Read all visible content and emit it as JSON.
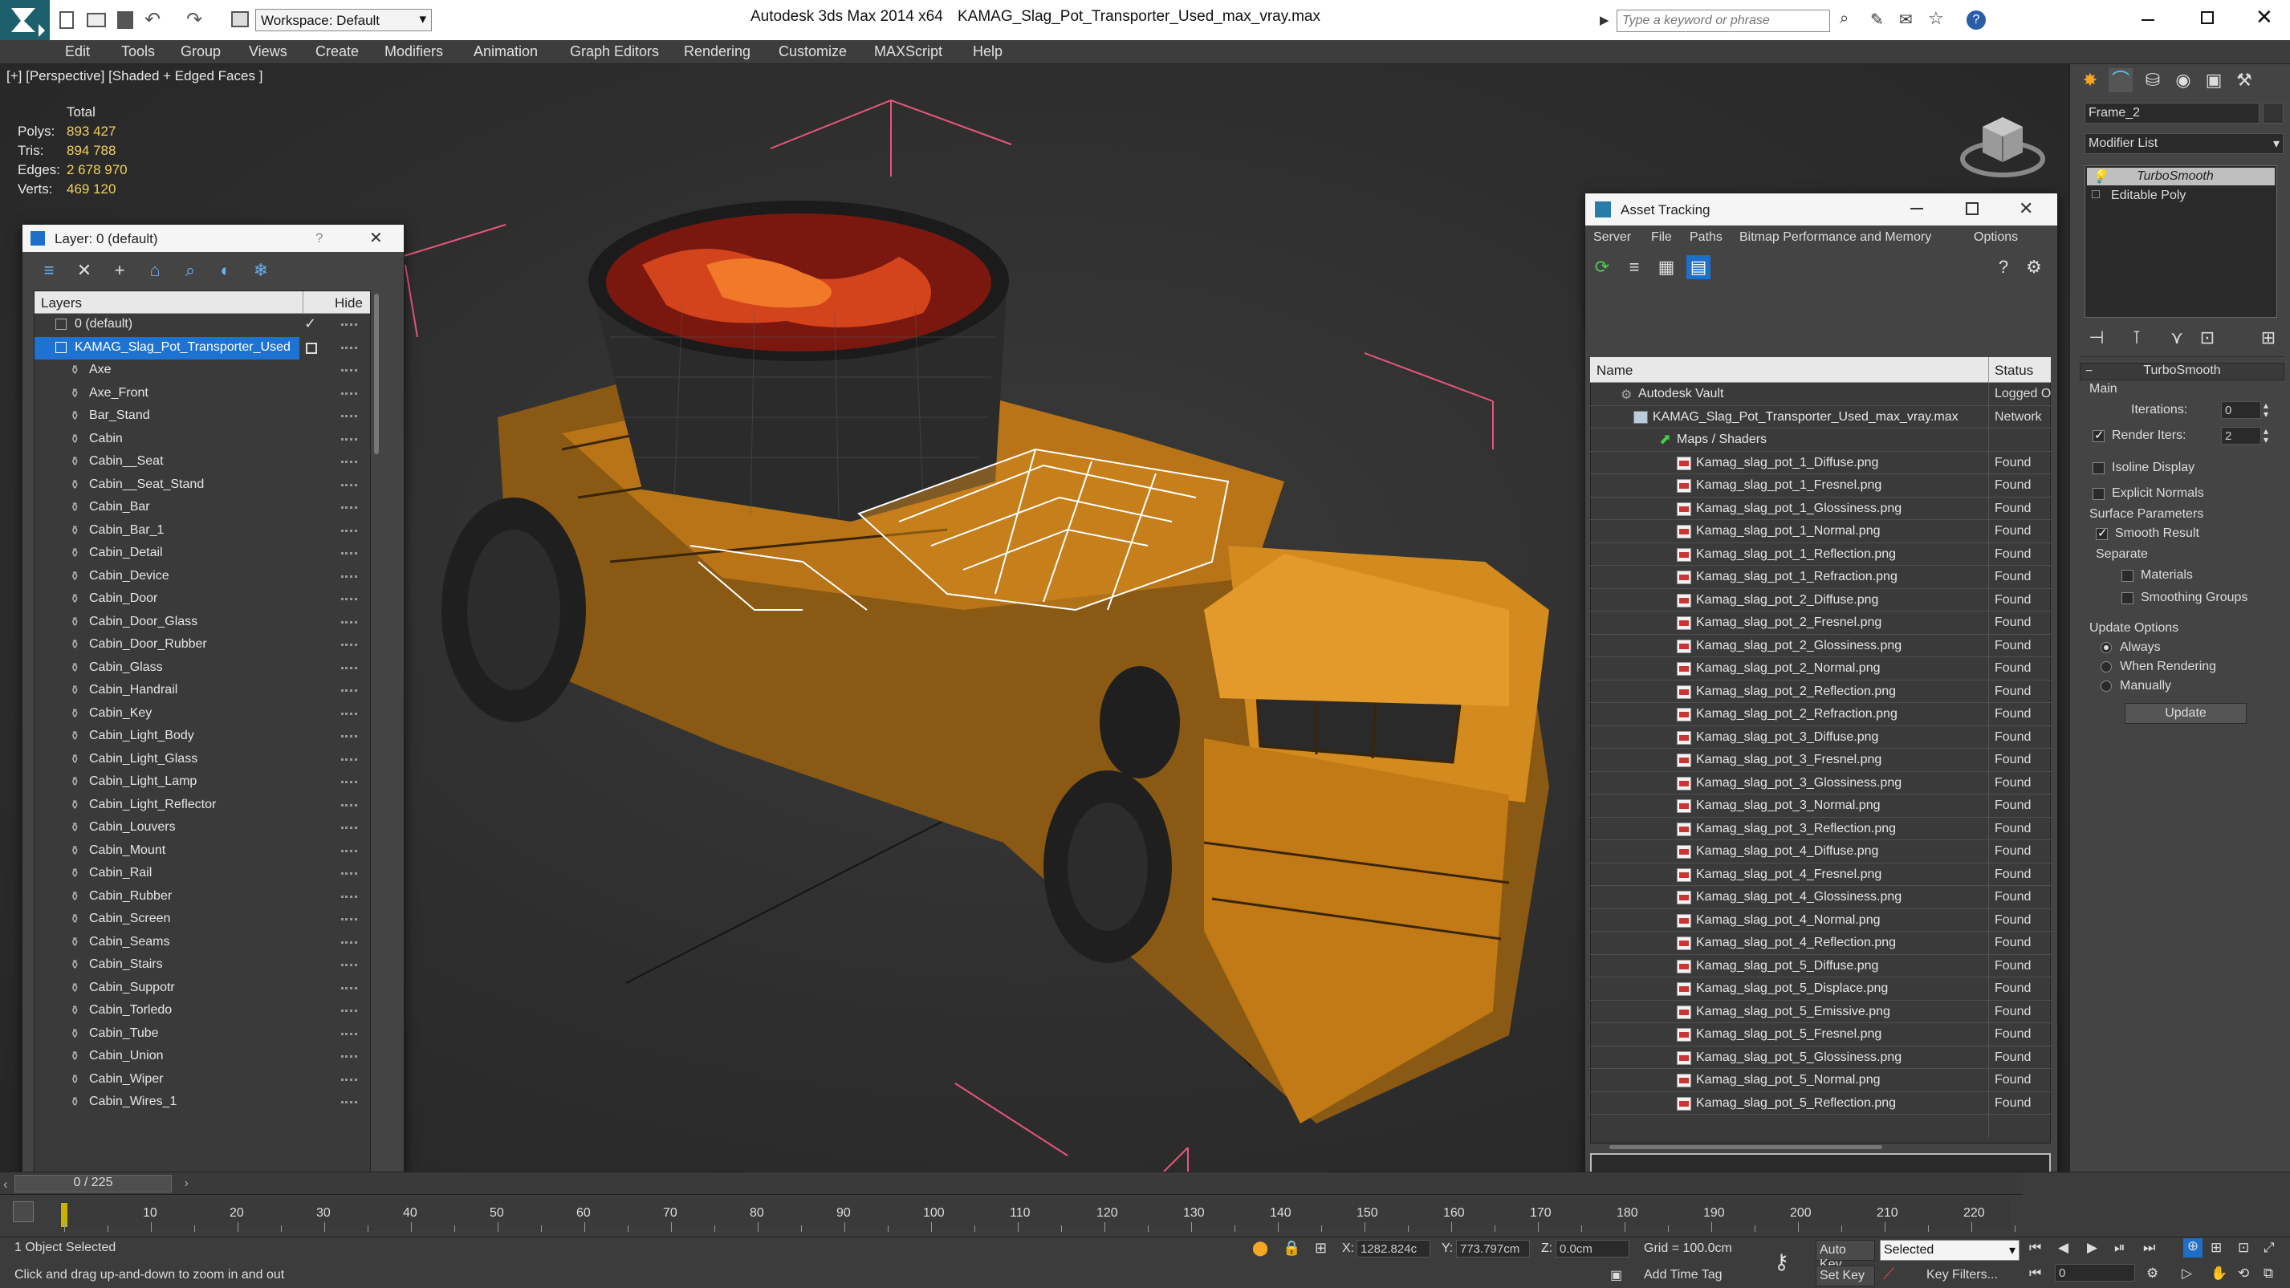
{
  "app": {
    "title": "Autodesk 3ds Max  2014 x64",
    "file": "KAMAG_Slag_Pot_Transporter_Used_max_vray.max",
    "workspace": "Workspace: Default",
    "search_placeholder": "Type a keyword or phrase"
  },
  "menu": [
    "Edit",
    "Tools",
    "Group",
    "Views",
    "Create",
    "Modifiers",
    "Animation",
    "Graph Editors",
    "Rendering",
    "Customize",
    "MAXScript",
    "Help"
  ],
  "viewport": {
    "label": "[+] [Perspective] [Shaded + Edged Faces ]",
    "stats": {
      "header": "Total",
      "rows": [
        {
          "label": "Polys:",
          "value": "893 427"
        },
        {
          "label": "Tris:",
          "value": "894 788"
        },
        {
          "label": "Edges:",
          "value": "2 678 970"
        },
        {
          "label": "Verts:",
          "value": "469 120"
        }
      ]
    }
  },
  "layer_panel": {
    "title": "Layer: 0 (default)",
    "help": "?",
    "col_layers": "Layers",
    "col_hide": "Hide",
    "default_layer": "0 (default)",
    "active_layer": "KAMAG_Slag_Pot_Transporter_Used",
    "objects": [
      "Axe",
      "Axe_Front",
      "Bar_Stand",
      "Cabin",
      "Cabin__Seat",
      "Cabin__Seat_Stand",
      "Cabin_Bar",
      "Cabin_Bar_1",
      "Cabin_Detail",
      "Cabin_Device",
      "Cabin_Door",
      "Cabin_Door_Glass",
      "Cabin_Door_Rubber",
      "Cabin_Glass",
      "Cabin_Handrail",
      "Cabin_Key",
      "Cabin_Light_Body",
      "Cabin_Light_Glass",
      "Cabin_Light_Lamp",
      "Cabin_Light_Reflector",
      "Cabin_Louvers",
      "Cabin_Mount",
      "Cabin_Rail",
      "Cabin_Rubber",
      "Cabin_Screen",
      "Cabin_Seams",
      "Cabin_Stairs",
      "Cabin_Suppotr",
      "Cabin_Torledo",
      "Cabin_Tube",
      "Cabin_Union",
      "Cabin_Wiper",
      "Cabin_Wires_1"
    ]
  },
  "asset_tracking": {
    "title": "Asset Tracking",
    "menu": [
      "Server",
      "File",
      "Paths",
      "Bitmap Performance and Memory",
      "Options"
    ],
    "col_name": "Name",
    "col_status": "Status",
    "vault": {
      "name": "Autodesk Vault",
      "status": "Logged O"
    },
    "file": {
      "name": "KAMAG_Slag_Pot_Transporter_Used_max_vray.max",
      "status": "Network"
    },
    "maps_folder": "Maps / Shaders",
    "maps": [
      {
        "name": "Kamag_slag_pot_1_Diffuse.png",
        "status": "Found"
      },
      {
        "name": "Kamag_slag_pot_1_Fresnel.png",
        "status": "Found"
      },
      {
        "name": "Kamag_slag_pot_1_Glossiness.png",
        "status": "Found"
      },
      {
        "name": "Kamag_slag_pot_1_Normal.png",
        "status": "Found"
      },
      {
        "name": "Kamag_slag_pot_1_Reflection.png",
        "status": "Found"
      },
      {
        "name": "Kamag_slag_pot_1_Refraction.png",
        "status": "Found"
      },
      {
        "name": "Kamag_slag_pot_2_Diffuse.png",
        "status": "Found"
      },
      {
        "name": "Kamag_slag_pot_2_Fresnel.png",
        "status": "Found"
      },
      {
        "name": "Kamag_slag_pot_2_Glossiness.png",
        "status": "Found"
      },
      {
        "name": "Kamag_slag_pot_2_Normal.png",
        "status": "Found"
      },
      {
        "name": "Kamag_slag_pot_2_Reflection.png",
        "status": "Found"
      },
      {
        "name": "Kamag_slag_pot_2_Refraction.png",
        "status": "Found"
      },
      {
        "name": "Kamag_slag_pot_3_Diffuse.png",
        "status": "Found"
      },
      {
        "name": "Kamag_slag_pot_3_Fresnel.png",
        "status": "Found"
      },
      {
        "name": "Kamag_slag_pot_3_Glossiness.png",
        "status": "Found"
      },
      {
        "name": "Kamag_slag_pot_3_Normal.png",
        "status": "Found"
      },
      {
        "name": "Kamag_slag_pot_3_Reflection.png",
        "status": "Found"
      },
      {
        "name": "Kamag_slag_pot_4_Diffuse.png",
        "status": "Found"
      },
      {
        "name": "Kamag_slag_pot_4_Fresnel.png",
        "status": "Found"
      },
      {
        "name": "Kamag_slag_pot_4_Glossiness.png",
        "status": "Found"
      },
      {
        "name": "Kamag_slag_pot_4_Normal.png",
        "status": "Found"
      },
      {
        "name": "Kamag_slag_pot_4_Reflection.png",
        "status": "Found"
      },
      {
        "name": "Kamag_slag_pot_5_Diffuse.png",
        "status": "Found"
      },
      {
        "name": "Kamag_slag_pot_5_Displace.png",
        "status": "Found"
      },
      {
        "name": "Kamag_slag_pot_5_Emissive.png",
        "status": "Found"
      },
      {
        "name": "Kamag_slag_pot_5_Fresnel.png",
        "status": "Found"
      },
      {
        "name": "Kamag_slag_pot_5_Glossiness.png",
        "status": "Found"
      },
      {
        "name": "Kamag_slag_pot_5_Normal.png",
        "status": "Found"
      },
      {
        "name": "Kamag_slag_pot_5_Reflection.png",
        "status": "Found"
      }
    ]
  },
  "command_panel": {
    "object_name": "Frame_2",
    "modifier_list": "Modifier List",
    "stack": [
      "TurboSmooth",
      "Editable Poly"
    ],
    "rollout_title": "TurboSmooth",
    "main_label": "Main",
    "iterations_label": "Iterations:",
    "iterations_value": "0",
    "render_iters_label": "Render Iters:",
    "render_iters_value": "2",
    "isoline": "Isoline Display",
    "explicit_normals": "Explicit Normals",
    "surface_params": "Surface Parameters",
    "smooth_result": "Smooth Result",
    "separate": "Separate",
    "materials": "Materials",
    "smoothing_groups": "Smoothing Groups",
    "update_options": "Update Options",
    "always": "Always",
    "when_rendering": "When Rendering",
    "manually": "Manually",
    "update_btn": "Update"
  },
  "timeline": {
    "frame_counter": "0 / 225",
    "ticks": [
      "10",
      "20",
      "30",
      "40",
      "50",
      "60",
      "70",
      "80",
      "90",
      "100",
      "110",
      "120",
      "130",
      "140",
      "150",
      "160",
      "170",
      "180",
      "190",
      "200",
      "210",
      "220"
    ]
  },
  "status": {
    "selection": "1 Object Selected",
    "prompt": "Click and drag up-and-down to zoom in and out",
    "x_label": "X:",
    "x_value": "1282.824c",
    "y_label": "Y:",
    "y_value": "773.797cm",
    "z_label": "Z:",
    "z_value": "0.0cm",
    "grid": "Grid = 100.0cm",
    "add_time_tag": "Add Time Tag",
    "auto_key": "Auto Key",
    "set_key": "Set Key",
    "selected": "Selected",
    "key_filters": "Key Filters...",
    "frame": "0"
  },
  "colors": {
    "accent_blue": "#1e6fc9",
    "layer_selected": "#1e73d2",
    "truck_orange": "#d38a1e",
    "selection_white": "#ffffff",
    "stats_yellow": "#f0d060"
  }
}
